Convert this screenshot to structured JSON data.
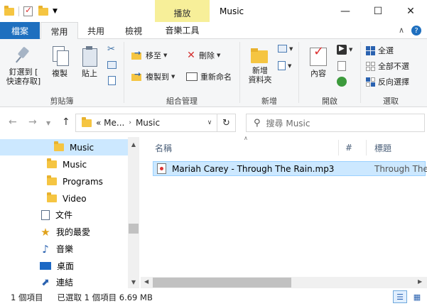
{
  "window": {
    "title": "Music",
    "contextual_tab": "播放",
    "minimize": "—",
    "maximize": "☐",
    "close": "✕"
  },
  "tabs": [
    {
      "label": "檔案"
    },
    {
      "label": "常用"
    },
    {
      "label": "共用"
    },
    {
      "label": "檢視"
    },
    {
      "label": "音樂工具"
    }
  ],
  "ribbon": {
    "clipboard": {
      "pin_label": "釘選到 [\n快速存取]",
      "copy_label": "複製",
      "paste_label": "貼上",
      "group_label": "剪貼簿"
    },
    "organize": {
      "move_label": "移至",
      "copy_to_label": "複製到",
      "delete_label": "刪除",
      "rename_label": "重新命名",
      "group_label": "組合管理"
    },
    "new": {
      "new_folder_label": "新增\n資料夾",
      "group_label": "新增"
    },
    "open": {
      "properties_label": "內容",
      "group_label": "開啟"
    },
    "select": {
      "select_all": "全選",
      "select_none": "全部不選",
      "invert": "反向選擇",
      "group_label": "選取"
    }
  },
  "address": {
    "crumbs": [
      "« Me...",
      "Music"
    ],
    "search_placeholder": "搜尋 Music"
  },
  "nav_pane": {
    "items": [
      {
        "label": "Music",
        "icon": "folder-icon",
        "selected": true
      },
      {
        "label": "Music",
        "icon": "folder-icon"
      },
      {
        "label": "Programs",
        "icon": "folder-icon"
      },
      {
        "label": "Video",
        "icon": "folder-icon"
      },
      {
        "label": "文件",
        "icon": "document-icon"
      },
      {
        "label": "我的最愛",
        "icon": "star-icon"
      },
      {
        "label": "音樂",
        "icon": "music-note-icon"
      },
      {
        "label": "桌面",
        "icon": "desktop-icon"
      },
      {
        "label": "連結",
        "icon": "link-icon"
      }
    ]
  },
  "content": {
    "columns": {
      "name": "名稱",
      "number": "#",
      "title": "標題"
    },
    "files": [
      {
        "name": "Mariah Carey - Through The Rain.mp3",
        "title": "Through The",
        "icon": "mp3-file-icon"
      }
    ]
  },
  "status": {
    "item_count": "1 個項目",
    "selection": "已選取 1 個項目  6.69 MB"
  },
  "colors": {
    "file_tab": "#1e6fbf",
    "contextual_tab": "#f7ef99",
    "selection": "#cce8ff"
  }
}
